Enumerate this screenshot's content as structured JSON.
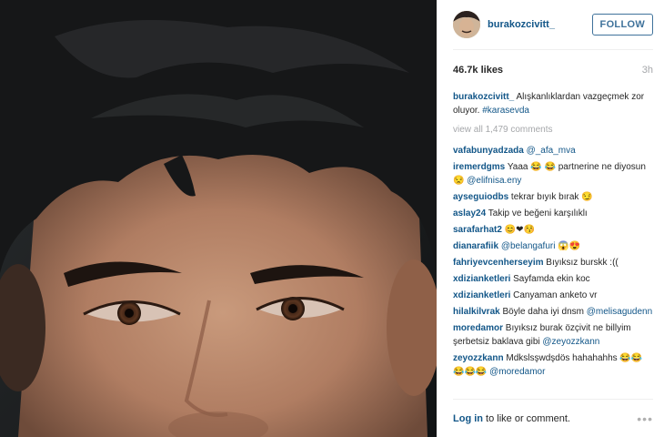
{
  "header": {
    "username": "burakozcivitt_",
    "follow_label": "FOLLOW"
  },
  "meta": {
    "likes": "46.7k likes",
    "time": "3h"
  },
  "caption": {
    "user": "burakozcivitt_",
    "text": " Alışkanlıklardan vazgeçmek zor oluyor. ",
    "hashtag": "#karasevda"
  },
  "view_all": "view all 1,479 comments",
  "comments": [
    {
      "user": "vafabunyadzada",
      "mention": "@_afa_mva",
      "text": "",
      "emoji": ""
    },
    {
      "user": "iremerdgms",
      "text": "Yaaa 😂 😂 partnerine ne diyosun 😒 ",
      "mention": "@elifnisa.eny",
      "emoji": ""
    },
    {
      "user": "ayseguiodbs",
      "text": "tekrar bıyık bırak 😏",
      "mention": "",
      "emoji": ""
    },
    {
      "user": "aslay24",
      "text": "Takip ve beğeni karşılıklı",
      "mention": "",
      "emoji": ""
    },
    {
      "user": "sarafarhat2",
      "text": "😊❤😚",
      "mention": "",
      "emoji": ""
    },
    {
      "user": "dianarafiik",
      "mention": "@belangafuri",
      "text": "",
      "emoji": " 😱😍"
    },
    {
      "user": "fahriyevcenherseyim",
      "text": "Bıyıksız burskk :((",
      "mention": "",
      "emoji": ""
    },
    {
      "user": "xdizianketleri",
      "text": "Sayfamda ekin koc",
      "mention": "",
      "emoji": ""
    },
    {
      "user": "xdizianketleri",
      "text": "Canyaman anketo vr",
      "mention": "",
      "emoji": ""
    },
    {
      "user": "hilalkilvrak",
      "text": "Böyle daha iyi dnsm ",
      "mention": "@melisagudenn",
      "emoji": ""
    },
    {
      "user": "moredamor",
      "text": "Bıyıksız burak özçivit ne billyim şerbetsiz baklava gibi ",
      "mention": "@zeyozzkann",
      "emoji": ""
    },
    {
      "user": "zeyozzkann",
      "text": "Mdkslsşwdşdös hahahahhs 😂😂😂😂😂 ",
      "mention": "@moredamor",
      "emoji": ""
    }
  ],
  "footer": {
    "login": "Log in",
    "text": " to like or comment.",
    "more": "•••"
  },
  "icons": {
    "more": "more-options-icon"
  },
  "colors": {
    "username_blue": "#125688",
    "follow_blue": "#3f729b",
    "muted_gray": "#a5a7aa"
  }
}
